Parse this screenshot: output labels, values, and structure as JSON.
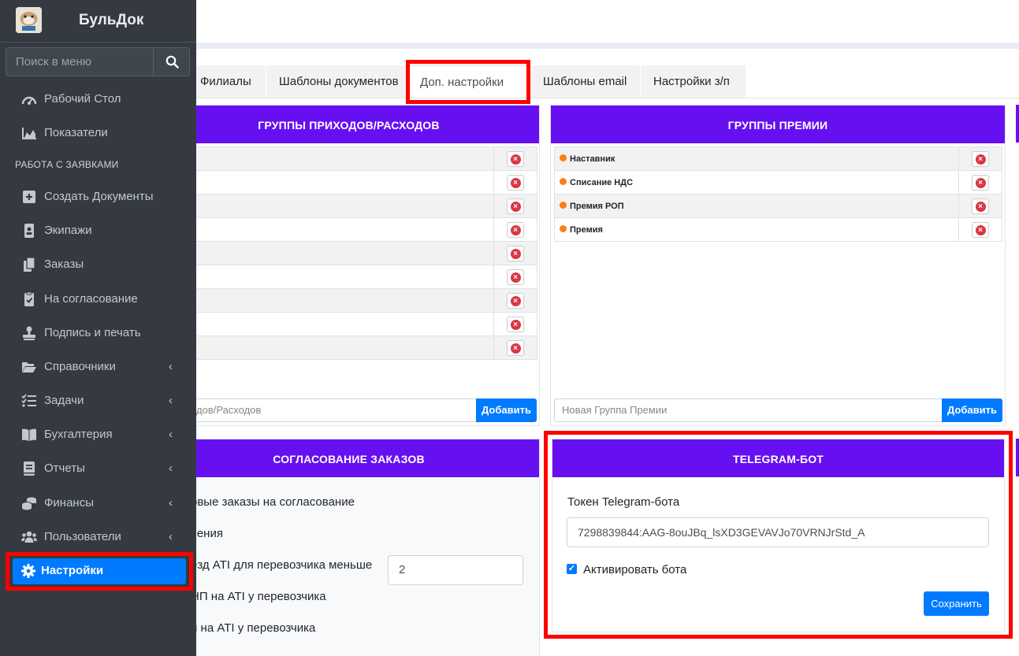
{
  "brand": {
    "name": "БульДок"
  },
  "search": {
    "placeholder": "Поиск в меню"
  },
  "nav": {
    "dashboard": "Рабочий Стол",
    "metrics": "Показатели",
    "section_header": "РАБОТА С ЗАЯВКАМИ",
    "create_docs": "Создать Документы",
    "crews": "Экипажи",
    "orders": "Заказы",
    "approval": "На согласование",
    "sign": "Подпись и печать",
    "references": "Справочники",
    "tasks": "Задачи",
    "accounting": "Бухгалтерия",
    "reports": "Отчеты",
    "finance": "Финансы",
    "users": "Пользователи",
    "settings": "Настройки"
  },
  "tabs": [
    "Филиалы",
    "Шаблоны документов",
    "Доп. настройки",
    "Шаблоны email",
    "Настройки з/п"
  ],
  "income_groups": {
    "title": "ГРУППЫ ПРИХОДОВ/РАСХОДОВ",
    "rows": [
      "",
      "",
      "",
      "",
      "",
      "",
      "",
      "",
      ""
    ],
    "input_value": "дов/Расходов",
    "add_label": "Добавить"
  },
  "bonus_groups": {
    "title": "ГРУППЫ ПРЕМИИ",
    "rows": [
      "Наставник",
      "Списание НДС",
      "Премия РОП",
      "Премия"
    ],
    "input_placeholder": "Новая Группа Премии",
    "add_label": "Добавить"
  },
  "order_approval": {
    "title": "СОГЛАСОВАНИЕ ЗАКАЗОВ",
    "rows": [
      "овые заказы на согласование",
      "чения",
      "ёзд ATI для перевозчика меньше",
      "НП на ATI у перевозчика",
      "и на ATI у перевозчика"
    ],
    "min_value": "2"
  },
  "telegram": {
    "title": "TELEGRAM-БОТ",
    "token_label": "Токен Telegram-бота",
    "token_value": "7298839844:AAG-8ouJBq_lsXD3GEVAVJo70VRNJrStd_A",
    "activate_label": "Активировать бота",
    "activate_checked": true,
    "save_label": "Сохранить"
  },
  "colors": {
    "header": "#6610f2",
    "primary": "#007bff",
    "highlight": "#ff0000",
    "sidebar": "#343a40"
  }
}
